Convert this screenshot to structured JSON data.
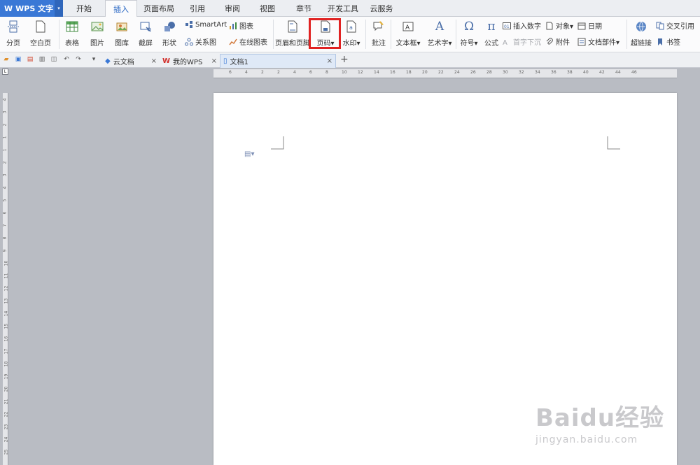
{
  "app": {
    "name": "WPS 文字",
    "logo": "W",
    "accent": "#3a78d6"
  },
  "menu": {
    "tabs": [
      "开始",
      "插入",
      "页面布局",
      "引用",
      "审阅",
      "视图",
      "章节",
      "开发工具",
      "云服务"
    ],
    "active": "插入"
  },
  "ribbon": {
    "page_break": "分页",
    "blank_page": "空白页",
    "table": "表格",
    "picture": "图片",
    "gallery": "图库",
    "screenshot": "截屏",
    "shapes": "形状",
    "smartart": "SmartArt",
    "chart": "图表",
    "relation_chart": "关系图",
    "online_chart": "在线图表",
    "header_footer": "页眉和页脚",
    "page_number": "页码",
    "watermark": "水印",
    "comment": "批注",
    "text_box": "文本框",
    "word_art": "艺术字",
    "symbol": "符号",
    "formula": "公式",
    "insert_number": "插入数字",
    "drop_cap": "首字下沉",
    "object": "对象",
    "attachment": "附件",
    "date": "日期",
    "doc_parts": "文档部件",
    "hyperlink": "超链接",
    "cross_ref": "交叉引用",
    "bookmark": "书签"
  },
  "tabs": {
    "items": [
      {
        "label": "云文档",
        "close": "×"
      },
      {
        "label": "我的WPS",
        "close": "×"
      },
      {
        "label": "文档1",
        "close": "×"
      }
    ],
    "new_tab": "+"
  },
  "ruler": {
    "h_marks": [
      "6",
      "4",
      "2",
      "2",
      "4",
      "6",
      "8",
      "10",
      "12",
      "14",
      "16",
      "18",
      "20",
      "22",
      "24",
      "26",
      "28",
      "30",
      "32",
      "34",
      "36",
      "38",
      "40",
      "42",
      "44",
      "46"
    ],
    "v_marks": [
      "4",
      "3",
      "2",
      "1",
      "1",
      "2",
      "3",
      "4",
      "5",
      "6",
      "7",
      "8",
      "9",
      "10",
      "11",
      "12",
      "13",
      "14",
      "15",
      "16",
      "17",
      "18",
      "19",
      "20",
      "21",
      "22",
      "23",
      "24",
      "25"
    ],
    "corner": "L"
  },
  "watermark": {
    "title": "Baidu经验",
    "url": "jingyan.baidu.com"
  },
  "highlight_color": "#e02222"
}
